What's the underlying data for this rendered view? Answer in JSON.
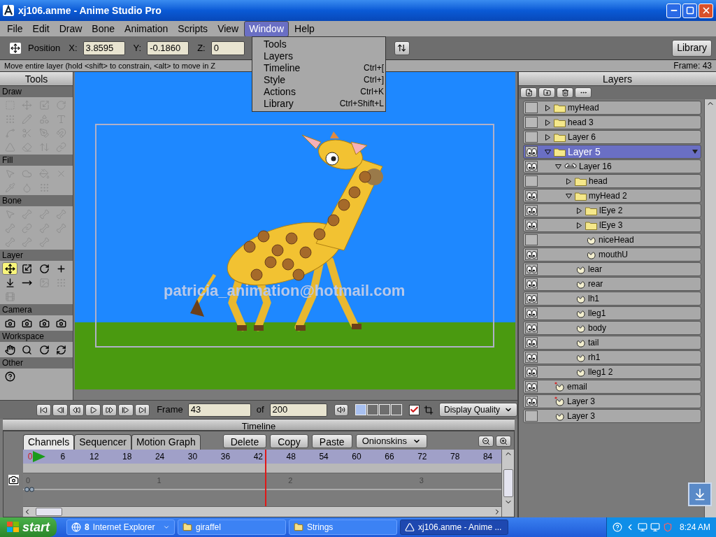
{
  "window": {
    "title": "xj106.anme - Anime Studio Pro"
  },
  "menu": [
    {
      "label": "File",
      "selected": false
    },
    {
      "label": "Edit",
      "selected": false
    },
    {
      "label": "Draw",
      "selected": false
    },
    {
      "label": "Bone",
      "selected": false
    },
    {
      "label": "Animation",
      "selected": false
    },
    {
      "label": "Scripts",
      "selected": false
    },
    {
      "label": "View",
      "selected": false
    },
    {
      "label": "Window",
      "selected": true
    },
    {
      "label": "Help",
      "selected": false
    }
  ],
  "window_menu": [
    {
      "label": "Tools"
    },
    {
      "label": "Layers"
    },
    {
      "label": "Timeline",
      "shortcut": "Ctrl+["
    },
    {
      "label": "Style",
      "shortcut": "Ctrl+]"
    },
    {
      "label": "Actions",
      "shortcut": "Ctrl+K"
    },
    {
      "label": "Library",
      "shortcut": "Ctrl+Shift+L"
    }
  ],
  "toolbar": {
    "label": "Position",
    "fields": [
      {
        "label": "X:",
        "value": "3.8595"
      },
      {
        "label": "Y:",
        "value": "-0.1860"
      },
      {
        "label": "Z:",
        "value": "0"
      }
    ],
    "library": "Library"
  },
  "status": {
    "hint": "Move entire layer (hold <shift> to constrain, <alt> to move in Z",
    "frame": "Frame: 43"
  },
  "tools": {
    "title": "Tools",
    "sections": [
      {
        "title": "Draw",
        "tools": [
          {
            "selected": false,
            "disabled": true
          },
          {
            "selected": false,
            "disabled": true
          },
          {
            "selected": false,
            "disabled": true
          },
          {
            "selected": false,
            "disabled": true
          },
          {
            "selected": false,
            "disabled": true
          },
          {
            "selected": false,
            "disabled": true
          },
          {
            "selected": false,
            "disabled": true
          },
          {
            "selected": false,
            "disabled": true
          },
          {
            "selected": false,
            "disabled": true
          },
          {
            "selected": false,
            "disabled": true
          },
          {
            "selected": false,
            "disabled": true
          },
          {
            "selected": false,
            "disabled": true
          },
          {
            "selected": false,
            "disabled": true
          },
          {
            "selected": false,
            "disabled": true
          },
          {
            "selected": false,
            "disabled": true
          },
          {
            "selected": false,
            "disabled": true
          }
        ]
      },
      {
        "title": "Fill",
        "tools": [
          {
            "selected": false,
            "disabled": true
          },
          {
            "selected": false,
            "disabled": true
          },
          {
            "selected": false,
            "disabled": true
          },
          {
            "selected": false,
            "disabled": true
          },
          {
            "selected": false,
            "disabled": true
          },
          {
            "selected": false,
            "disabled": true
          },
          {
            "selected": false,
            "disabled": true
          }
        ]
      },
      {
        "title": "Bone",
        "tools": [
          {
            "selected": false,
            "disabled": true
          },
          {
            "selected": false,
            "disabled": true
          },
          {
            "selected": false,
            "disabled": true
          },
          {
            "selected": false,
            "disabled": true
          },
          {
            "selected": false,
            "disabled": true
          },
          {
            "selected": false,
            "disabled": true
          },
          {
            "selected": false,
            "disabled": true
          },
          {
            "selected": false,
            "disabled": true
          },
          {
            "selected": false,
            "disabled": true
          },
          {
            "selected": false,
            "disabled": true
          },
          {
            "selected": false,
            "disabled": true
          }
        ]
      },
      {
        "title": "Layer",
        "tools": [
          {
            "selected": true,
            "disabled": false
          },
          {
            "selected": false,
            "disabled": false
          },
          {
            "selected": false,
            "disabled": false
          },
          {
            "selected": false,
            "disabled": false
          },
          {
            "selected": false,
            "disabled": false
          },
          {
            "selected": false,
            "disabled": false
          },
          {
            "selected": false,
            "disabled": true
          },
          {
            "selected": false,
            "disabled": true
          },
          {
            "selected": false,
            "disabled": true
          }
        ]
      },
      {
        "title": "Camera",
        "tools": [
          {
            "selected": false,
            "disabled": false
          },
          {
            "selected": false,
            "disabled": false
          },
          {
            "selected": false,
            "disabled": false
          },
          {
            "selected": false,
            "disabled": false
          }
        ]
      },
      {
        "title": "Workspace",
        "tools": [
          {
            "selected": false,
            "disabled": false
          },
          {
            "selected": false,
            "disabled": false
          },
          {
            "selected": false,
            "disabled": false
          },
          {
            "selected": false,
            "disabled": false
          }
        ]
      },
      {
        "title": "Other",
        "tools": [
          {
            "selected": false,
            "disabled": false
          }
        ]
      }
    ]
  },
  "canvas": {
    "text": "patricia_animation@hotmail.com"
  },
  "playback": {
    "frame_label": "Frame",
    "frame": "43",
    "of_label": "of",
    "total": "200",
    "views": [
      {
        "selected": true
      },
      {
        "selected": false
      },
      {
        "selected": false
      },
      {
        "selected": false
      }
    ],
    "checked": true,
    "quality": "Display Quality"
  },
  "timeline": {
    "title": "Timeline",
    "tabs": [
      {
        "label": "Channels",
        "selected": true
      },
      {
        "label": "Sequencer",
        "selected": false
      },
      {
        "label": "Motion Graph",
        "selected": false
      }
    ],
    "buttons": [
      "Delete",
      "Copy",
      "Paste"
    ],
    "onionskins": "Onionskins",
    "ruler": [
      "0",
      "6",
      "12",
      "18",
      "24",
      "30",
      "36",
      "42",
      "48",
      "54",
      "60",
      "66",
      "72",
      "78",
      "84"
    ],
    "seconds": [
      "0",
      "1",
      "2",
      "3"
    ],
    "playhead": {
      "level": 0.512
    }
  },
  "layers": {
    "title": "Layers",
    "items": [
      {
        "name": "myHead",
        "kind": "group",
        "visible": false,
        "expanded": false,
        "selected": false
      },
      {
        "name": "head 3",
        "kind": "group",
        "visible": false,
        "expanded": false,
        "selected": false
      },
      {
        "name": "Layer 6",
        "kind": "group",
        "visible": false,
        "expanded": false,
        "selected": false
      },
      {
        "name": "Layer 5",
        "kind": "group",
        "visible": true,
        "expanded": true,
        "selected": true,
        "children": [
          {
            "name": "Layer 16",
            "kind": "bone",
            "visible": true,
            "expanded": true,
            "selected": false,
            "children": [
              {
                "name": "head",
                "kind": "group",
                "visible": false,
                "expanded": false,
                "selected": false
              },
              {
                "name": "myHead 2",
                "kind": "group",
                "visible": true,
                "expanded": true,
                "selected": false,
                "children": [
                  {
                    "name": "lEye 2",
                    "kind": "group",
                    "visible": true,
                    "expanded": false,
                    "selected": false
                  },
                  {
                    "name": "lEye 3",
                    "kind": "group",
                    "visible": true,
                    "expanded": false,
                    "selected": false
                  },
                  {
                    "name": "niceHead",
                    "kind": "vector",
                    "visible": false,
                    "selected": false,
                    "marked": false
                  },
                  {
                    "name": "mouthU",
                    "kind": "vector",
                    "visible": true,
                    "selected": false,
                    "marked": false
                  }
                ]
              },
              {
                "name": "lear",
                "kind": "vector",
                "visible": true,
                "selected": false,
                "marked": false
              },
              {
                "name": "rear",
                "kind": "vector",
                "visible": true,
                "selected": false,
                "marked": false
              },
              {
                "name": "lh1",
                "kind": "vector",
                "visible": true,
                "selected": false,
                "marked": false
              },
              {
                "name": "lleg1",
                "kind": "vector",
                "visible": true,
                "selected": false,
                "marked": false
              },
              {
                "name": "body",
                "kind": "vector",
                "visible": true,
                "selected": false,
                "marked": false
              },
              {
                "name": "tail",
                "kind": "vector",
                "visible": true,
                "selected": false,
                "marked": false
              },
              {
                "name": "rh1",
                "kind": "vector",
                "visible": true,
                "selected": false,
                "marked": false
              },
              {
                "name": "lleg1 2",
                "kind": "vector",
                "visible": true,
                "selected": false,
                "marked": false
              }
            ]
          }
        ]
      },
      {
        "name": "email",
        "kind": "vector",
        "visible": true,
        "selected": false,
        "marked": true
      },
      {
        "name": "Layer 3",
        "kind": "vector",
        "visible": true,
        "selected": false,
        "marked": true
      },
      {
        "name": "Layer 3",
        "kind": "vector",
        "visible": false,
        "selected": false,
        "marked": false
      }
    ]
  },
  "taskbar": {
    "start": "start",
    "items": [
      {
        "kind": "browser",
        "count": "8",
        "label": "Internet Explorer",
        "selected": false
      },
      {
        "kind": "folder",
        "label": "giraffel",
        "selected": false
      },
      {
        "kind": "folder",
        "label": "Strings",
        "selected": false
      },
      {
        "kind": "app",
        "label": "xj106.anme - Anime ...",
        "selected": true
      }
    ],
    "clock": "8:24 AM"
  }
}
